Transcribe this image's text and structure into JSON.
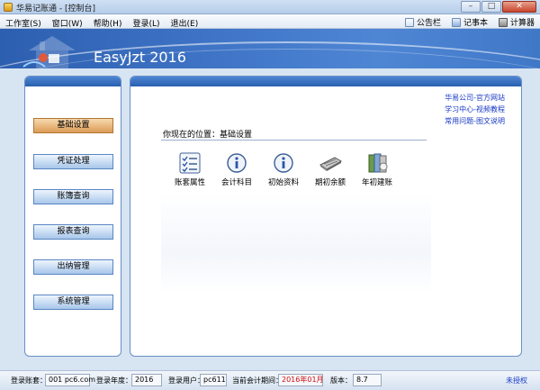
{
  "window": {
    "title": "华易记账通 - [控制台]",
    "controls": {
      "minimize": "–",
      "maximize": "□",
      "close": "✕"
    }
  },
  "menu": {
    "items": [
      "工作室(S)",
      "窗口(W)",
      "帮助(H)",
      "登录(L)",
      "退出(E)"
    ],
    "tools": [
      {
        "label": "公告栏",
        "icon": "bulletin-icon"
      },
      {
        "label": "记事本",
        "icon": "notepad-icon"
      },
      {
        "label": "计算器",
        "icon": "calculator-icon"
      }
    ]
  },
  "banner": {
    "product": "EasyJzt 2016"
  },
  "nav": {
    "items": [
      {
        "label": "基础设置",
        "active": true
      },
      {
        "label": "凭证处理",
        "active": false
      },
      {
        "label": "账簿查询",
        "active": false
      },
      {
        "label": "报表查询",
        "active": false
      },
      {
        "label": "出纳管理",
        "active": false
      },
      {
        "label": "系统管理",
        "active": false
      }
    ]
  },
  "main": {
    "links": [
      "华易公司-官方网站",
      "学习中心-视频教程",
      "常用问题-图文说明"
    ],
    "location": "你现在的位置：基础设置",
    "icons": [
      {
        "label": "账套属性",
        "icon": "list-checklist-icon"
      },
      {
        "label": "会计科目",
        "icon": "info-icon"
      },
      {
        "label": "初始资料",
        "icon": "info-icon"
      },
      {
        "label": "期初余额",
        "icon": "keyboard-icon"
      },
      {
        "label": "年初建账",
        "icon": "books-icon"
      }
    ]
  },
  "status": {
    "account_label": "登录账套：",
    "account_value": "001 pc6.com",
    "year_label": "登录年度：",
    "year_value": "2016",
    "user_label": "登录用户：",
    "user_value": "pc611",
    "period_label": "当前会计期间：",
    "period_value": "2016年01月",
    "version_label": "版本：",
    "version_value": "8.7",
    "license": "未授权"
  },
  "colors": {
    "accent": "#2a5fb0",
    "active_nav": "#dc9c56",
    "link": "#1638c4",
    "period": "#d31010"
  }
}
